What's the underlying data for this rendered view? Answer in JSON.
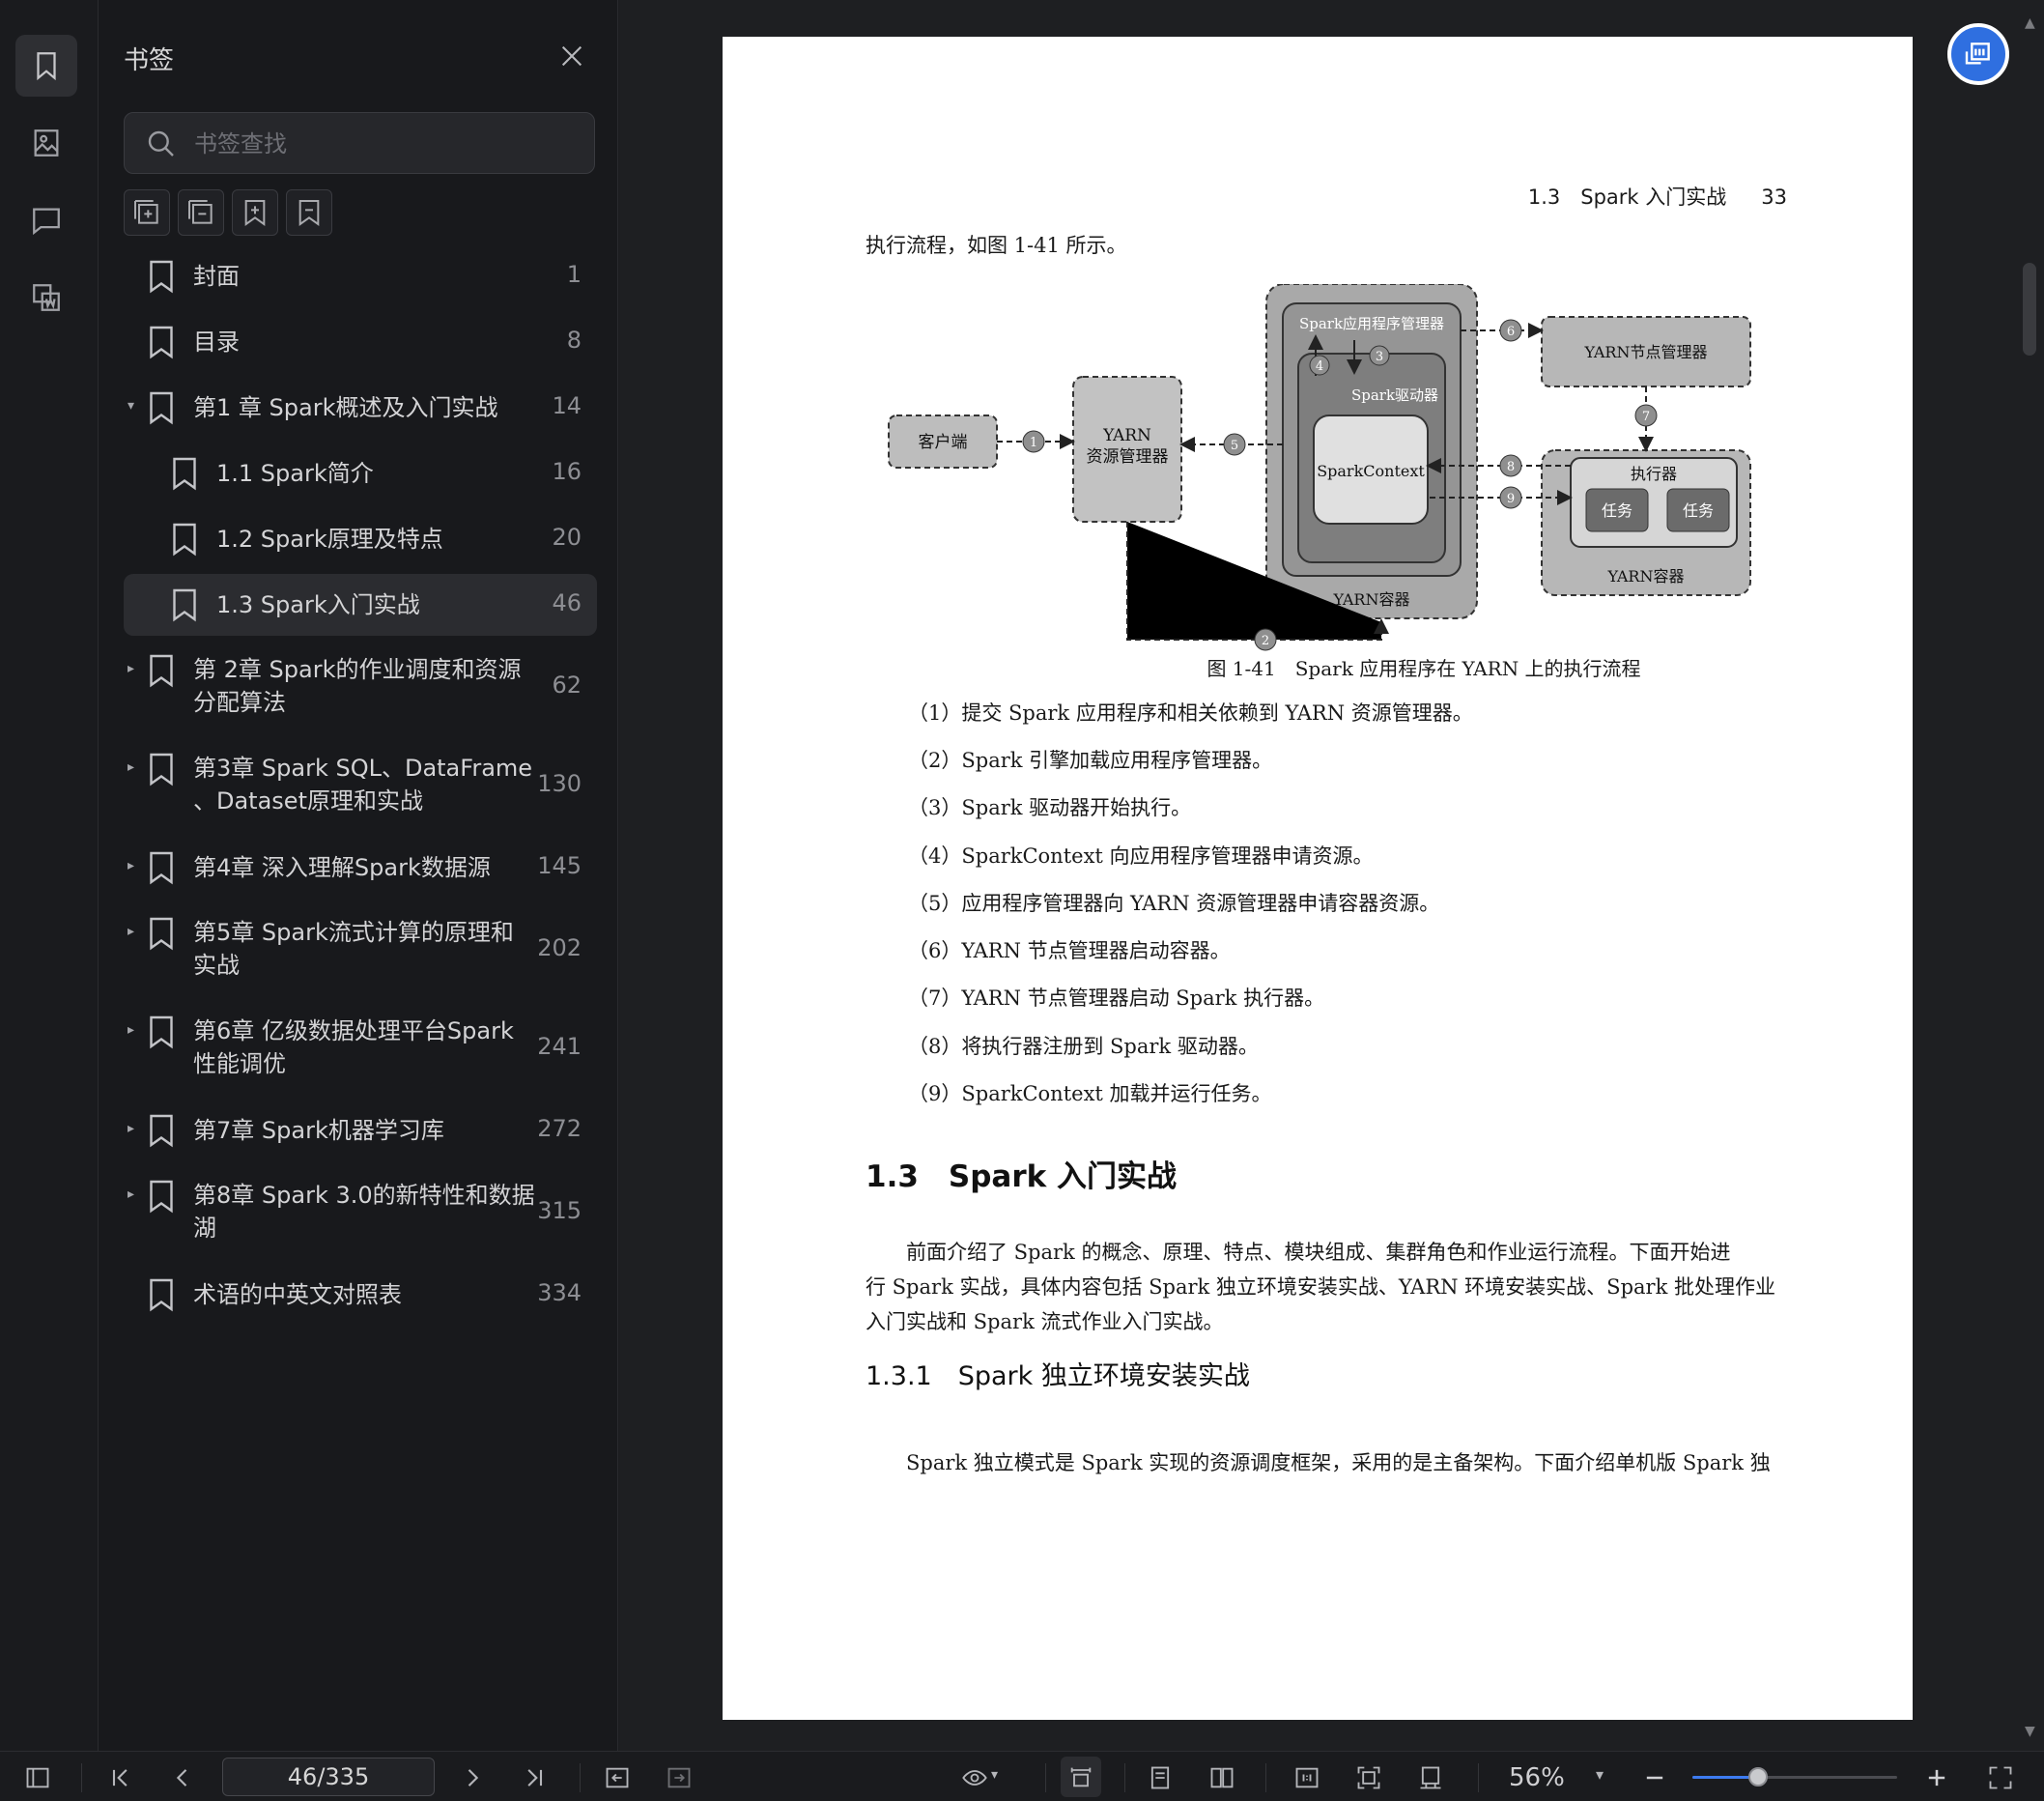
{
  "panel": {
    "title": "书签",
    "search_placeholder": "书签查找"
  },
  "bookmarks": [
    {
      "label": "封面",
      "page": "1",
      "caret": "",
      "level": 0
    },
    {
      "label": "目录",
      "page": "8",
      "caret": "",
      "level": 0
    },
    {
      "label": "第1 章 Spark概述及入门实战",
      "page": "14",
      "caret": "▾",
      "level": 0
    },
    {
      "label": "1.1 Spark简介",
      "page": "16",
      "caret": "",
      "level": 1
    },
    {
      "label": "1.2 Spark原理及特点",
      "page": "20",
      "caret": "",
      "level": 1
    },
    {
      "label": "1.3 Spark入门实战",
      "page": "46",
      "caret": "",
      "level": 1,
      "active": true
    },
    {
      "label": "第 2章 Spark的作业调度和资源",
      "label2": "分配算法",
      "page": "62",
      "caret": "▸",
      "level": 0
    },
    {
      "label": "第3章 Spark SQL、DataFrame",
      "label2": "、Dataset原理和实战",
      "page": "130",
      "caret": "▸",
      "level": 0
    },
    {
      "label": "第4章 深入理解Spark数据源",
      "page": "145",
      "caret": "▸",
      "level": 0
    },
    {
      "label": "第5章 Spark流式计算的原理和",
      "label2": "实战",
      "page": "202",
      "caret": "▸",
      "level": 0
    },
    {
      "label": "第6章 亿级数据处理平台Spark",
      "label2": "性能调优",
      "page": "241",
      "caret": "▸",
      "level": 0
    },
    {
      "label": "第7章 Spark机器学习库",
      "page": "272",
      "caret": "▸",
      "level": 0
    },
    {
      "label": "第8章 Spark 3.0的新特性和数据",
      "label2": "湖",
      "page": "315",
      "caret": "▸",
      "level": 0
    },
    {
      "label": "术语的中英文对照表",
      "page": "334",
      "caret": "",
      "level": 0
    }
  ],
  "page": {
    "running_head": "1.3　Spark 入门实战",
    "page_number": "33",
    "intro": "执行流程，如图 1-41 所示。",
    "diagram": {
      "client": "客户端",
      "rm_line1": "YARN",
      "rm_line2": "资源管理器",
      "app_master": "Spark应用程序管理器",
      "driver": "Spark驱动器",
      "spark_context": "SparkContext",
      "yarn_container_left": "YARN容器",
      "node_manager": "YARN节点管理器",
      "executor": "执行器",
      "task1": "任务",
      "task2": "任务",
      "yarn_container_right": "YARN容器",
      "n1": "1",
      "n2": "2",
      "n3": "3",
      "n4": "4",
      "n5": "5",
      "n6": "6",
      "n7": "7",
      "n8": "8",
      "n9": "9"
    },
    "caption": "图 1-41　Spark 应用程序在 YARN 上的执行流程",
    "steps": [
      "（1）提交 Spark 应用程序和相关依赖到 YARN 资源管理器。",
      "（2）Spark 引擎加载应用程序管理器。",
      "（3）Spark 驱动器开始执行。",
      "（4）SparkContext 向应用程序管理器申请资源。",
      "（5）应用程序管理器向 YARN 资源管理器申请容器资源。",
      "（6）YARN 节点管理器启动容器。",
      "（7）YARN 节点管理器启动 Spark 执行器。",
      "（8）将执行器注册到 Spark 驱动器。",
      "（9）SparkContext 加载并运行任务。"
    ],
    "section_title": "1.3　Spark 入门实战",
    "section_para": [
      "　　前面介绍了 Spark 的概念、原理、特点、模块组成、集群角色和作业运行流程。下面开始进",
      "行 Spark 实战，具体内容包括 Spark 独立环境安装实战、YARN 环境安装实战、Spark 批处理作业",
      "入门实战和 Spark 流式作业入门实战。"
    ],
    "subsection_title": "1.3.1　Spark 独立环境安装实战",
    "subsection_para": "　　Spark 独立模式是 Spark 实现的资源调度框架，采用的是主备架构。下面介绍单机版 Spark 独"
  },
  "toolbar": {
    "page_indicator": "46/335",
    "zoom": "56%",
    "zoom_fraction": 0.32
  }
}
